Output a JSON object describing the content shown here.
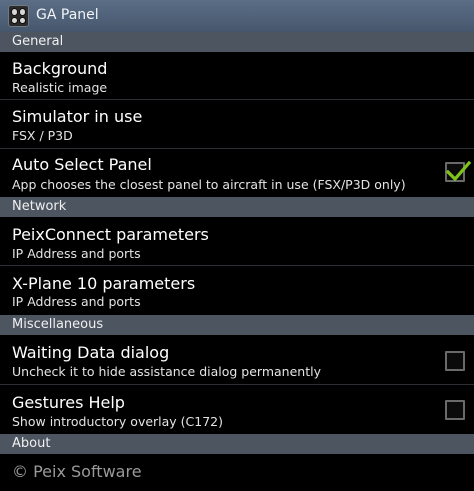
{
  "app": {
    "title": "GA Panel"
  },
  "sections": {
    "general": "General",
    "network": "Network",
    "misc": "Miscellaneous",
    "about": "About"
  },
  "items": {
    "background": {
      "title": "Background",
      "summary": "Realistic image"
    },
    "simulator": {
      "title": "Simulator in use",
      "summary": "FSX / P3D"
    },
    "auto_select": {
      "title": "Auto Select Panel",
      "summary": "App chooses the closest panel to aircraft in use (FSX/P3D only)",
      "checked": true
    },
    "peixconnect": {
      "title": "PeixConnect parameters",
      "summary": "IP Address and ports"
    },
    "xplane": {
      "title": "X-Plane 10 parameters",
      "summary": "IP Address and ports"
    },
    "waiting": {
      "title": "Waiting Data dialog",
      "summary": "Uncheck it to hide assistance dialog permanently",
      "checked": false
    },
    "gestures": {
      "title": "Gestures Help",
      "summary": "Show introductory overlay (C172)",
      "checked": false
    }
  },
  "footer": {
    "text": "© Peix Software"
  },
  "colors": {
    "accent_check": "#7fc31c",
    "section_bg": "#4d5561",
    "titlebar": "#52637a"
  }
}
